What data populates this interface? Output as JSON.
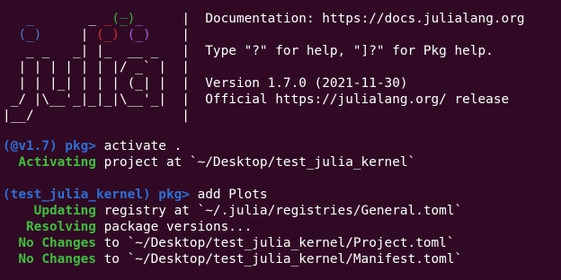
{
  "colors": {
    "background": "#300a24",
    "prompt_blue": "#2f6fd6",
    "status_green": "#3fbf3f",
    "logo_blue": "#4a7ad6",
    "logo_red": "#e02626",
    "logo_green": "#3cb043",
    "logo_purple": "#b25bd6"
  },
  "banner": {
    "line1": "Documentation: https://docs.julialang.org",
    "line3": "Type \"?\" for help, \"]?\" for Pkg help.",
    "line5": "Version 1.7.0 (2021-11-30)",
    "line6": "Official https://julialang.org/ release"
  },
  "session": [
    {
      "prompt": "(@v1.7) pkg>",
      "command": " activate ."
    },
    {
      "status": "Activating",
      "text": " project at `~/Desktop/test_julia_kernel`"
    },
    {
      "prompt": "(test_julia_kernel) pkg>",
      "command": " add Plots"
    },
    {
      "status": "Updating",
      "text": " registry at `~/.julia/registries/General.toml`"
    },
    {
      "status": "Resolving",
      "text": " package versions..."
    },
    {
      "status": "No Changes",
      "text": " to `~/Desktop/test_julia_kernel/Project.toml`"
    },
    {
      "status": "No Changes",
      "text": " to `~/Desktop/test_julia_kernel/Manifest.toml`"
    }
  ]
}
